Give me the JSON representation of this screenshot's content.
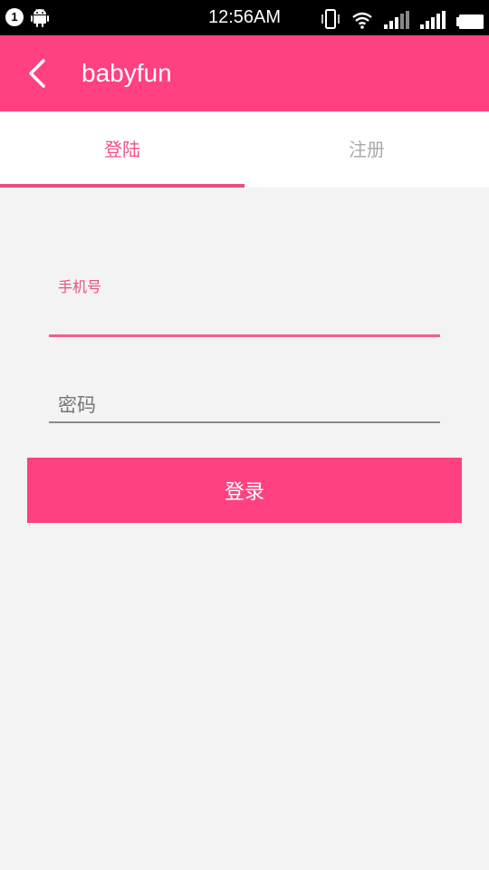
{
  "status_bar": {
    "notification_count": "1",
    "time": "12:56AM",
    "icons": [
      "notification-icon",
      "android-icon",
      "vibrate-icon",
      "wifi-icon",
      "signal-icon",
      "signal-icon",
      "battery-icon"
    ]
  },
  "app_bar": {
    "title": "babyfun",
    "back_icon": "back-arrow-icon"
  },
  "tabs": [
    {
      "label": "登陆",
      "active": true
    },
    {
      "label": "注册",
      "active": false
    }
  ],
  "form": {
    "phone_label": "手机号",
    "phone_value": "",
    "password_placeholder": "密码",
    "password_value": "",
    "login_button": "登录"
  },
  "colors": {
    "accent": "#ff4081",
    "tab_active": "#f0508a",
    "tab_inactive": "#aaaaaa",
    "background": "#f3f3f3"
  }
}
